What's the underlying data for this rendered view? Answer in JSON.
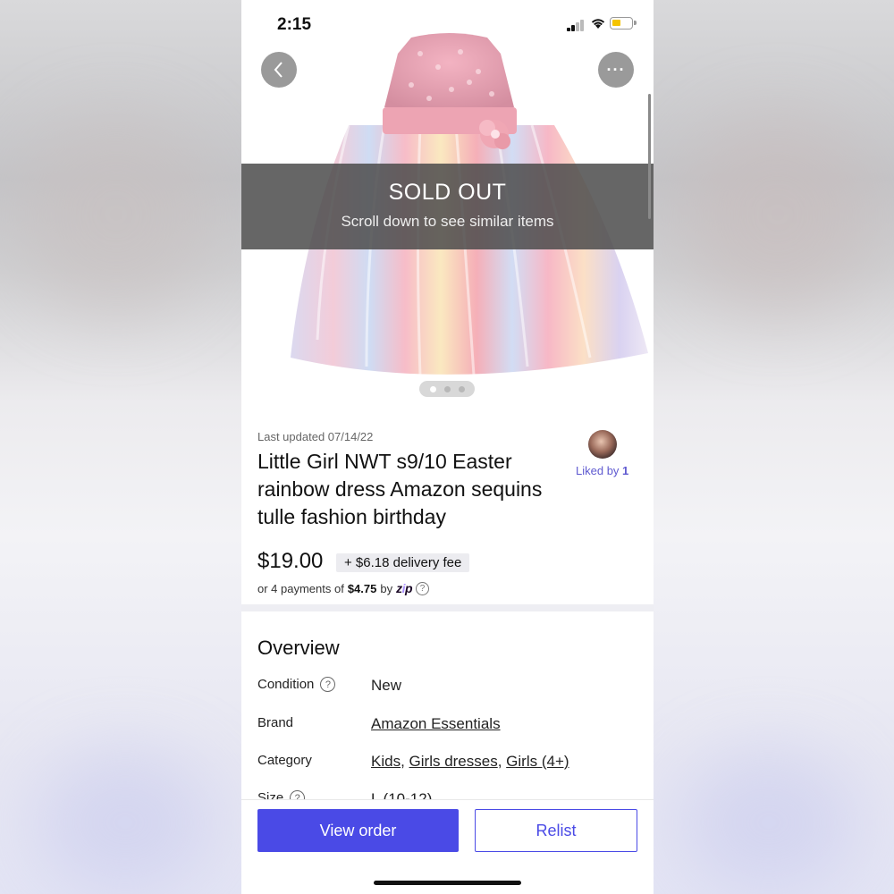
{
  "status_bar": {
    "time": "2:15"
  },
  "hero": {
    "sold_title": "SOLD OUT",
    "sold_subtitle": "Scroll down to see similar items",
    "more_label": "···"
  },
  "listing": {
    "last_updated": "Last updated 07/14/22",
    "title": "Little Girl NWT s9/10 Easter rainbow dress Amazon sequins tulle fashion birthday",
    "liked_prefix": "Liked by ",
    "liked_count": "1",
    "price": "$19.00",
    "delivery": "+ $6.18 delivery fee",
    "payments_prefix": "or 4 payments of",
    "payments_amount": "$4.75",
    "payments_by": "by",
    "zip_brand": "zip"
  },
  "overview": {
    "title": "Overview",
    "condition_label": "Condition",
    "condition_value": "New",
    "brand_label": "Brand",
    "brand_value": "Amazon Essentials",
    "category_label": "Category",
    "category_1": "Kids",
    "category_2": "Girls dresses",
    "category_3": "Girls (4+)",
    "size_label": "Size",
    "size_value": "L (10-12)"
  },
  "actions": {
    "view_order": "View order",
    "relist": "Relist"
  },
  "colors": {
    "accent": "#4a4ae6",
    "liked": "#5f5ad0",
    "banner": "#4b4b4b"
  }
}
